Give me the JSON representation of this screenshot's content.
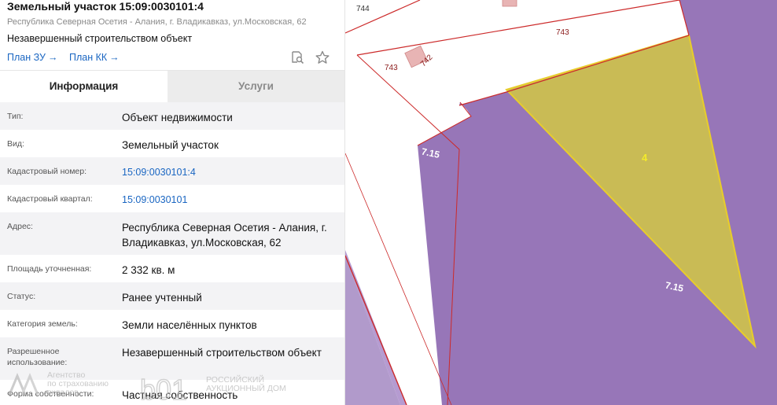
{
  "header": {
    "title": "Земельный участок 15:09:0030101:4",
    "address": "Республика Северная Осетия - Алания, г. Владикавказ, ул.Московская, 62",
    "object_status": "Незавершенный строительством объект",
    "plan_zu_label": "План ЗУ",
    "plan_kk_label": "План КК",
    "arrow_glyph": "→",
    "icons": [
      "search-document-icon",
      "star-icon"
    ]
  },
  "tabs": {
    "info_label": "Информация",
    "services_label": "Услуги",
    "active": "info"
  },
  "info": [
    {
      "label": "Тип:",
      "value": "Объект недвижимости",
      "link": false
    },
    {
      "label": "Вид:",
      "value": "Земельный участок",
      "link": false
    },
    {
      "label": "Кадастровый номер:",
      "value": "15:09:0030101:4",
      "link": true
    },
    {
      "label": "Кадастровый квартал:",
      "value": "15:09:0030101",
      "link": true
    },
    {
      "label": "Адрес:",
      "value": "Республика Северная Осетия - Алания, г. Владикавказ, ул.Московская, 62",
      "link": false
    },
    {
      "label": "Площадь уточненная:",
      "value": "2 332 кв. м",
      "link": false
    },
    {
      "label": "Статус:",
      "value": "Ранее учтенный",
      "link": false
    },
    {
      "label": "Категория земель:",
      "value": "Земли населённых пунктов",
      "link": false
    },
    {
      "label": "Разрешенное использование:",
      "value": "Незавершенный строительством объект",
      "link": false
    },
    {
      "label": "Форма собственности:",
      "value": "Частная собственность",
      "link": false
    }
  ],
  "watermarks": {
    "left_lines": [
      "Агентство",
      "по страхованию",
      "вкладов"
    ],
    "right_lines": [
      "РОССИЙСКИЙ",
      "АУКЦИОННЫЙ ДОМ"
    ]
  },
  "map": {
    "labels": {
      "parcel_744": "744",
      "parcel_743_top": "743",
      "parcel_743_left": "743",
      "parcel_742": "742",
      "zone_left": "7.15",
      "zone_right": "7.15",
      "parcel_selected": "4"
    },
    "colors": {
      "zone_purple": "#9776b8",
      "zone_purple_light": "#b19acb",
      "selected_fill": "#c9bb55",
      "selected_stroke": "#e8cd2b",
      "boundary_red": "#cc2a2a",
      "building_pink": "#e8b4b4",
      "link_blue": "#1a66c2"
    }
  }
}
